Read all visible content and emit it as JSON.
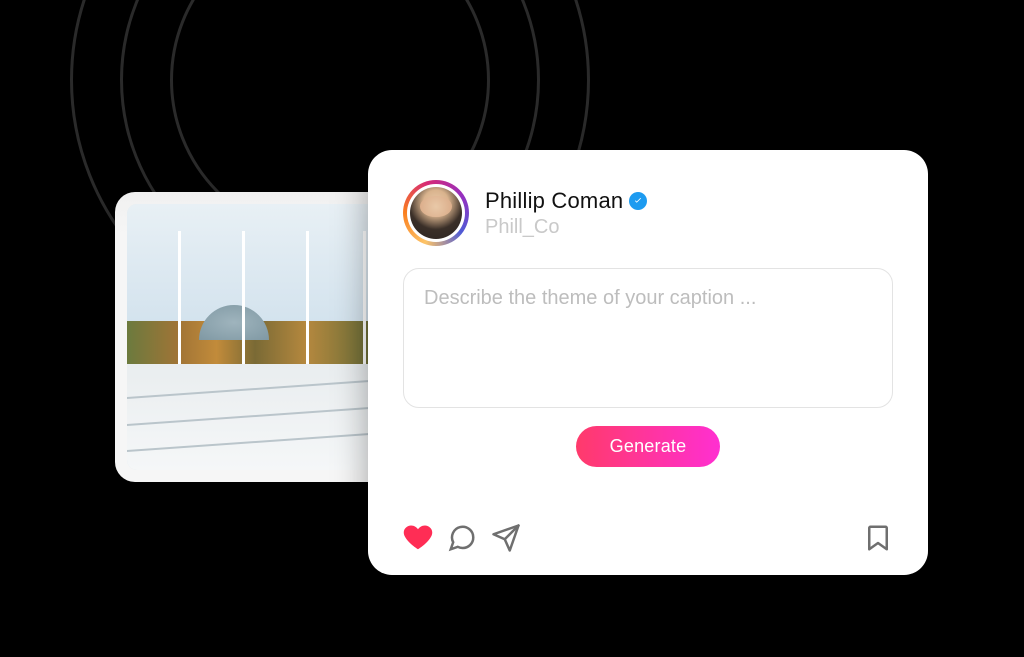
{
  "profile": {
    "display_name": "Phillip Coman",
    "handle": "Phill_Co",
    "verified": true
  },
  "caption_input": {
    "placeholder": "Describe the theme of your caption ...",
    "value": ""
  },
  "buttons": {
    "generate_label": "Generate"
  },
  "icons": {
    "heart": "heart-icon",
    "comment": "comment-icon",
    "share": "share-icon",
    "bookmark": "bookmark-icon",
    "verified": "verified-badge-icon"
  },
  "colors": {
    "heart_fill": "#ff2d55",
    "verified_badge": "#1d9bf0",
    "generate_gradient_start": "#ff3a6b",
    "generate_gradient_end": "#ff2fd1"
  }
}
